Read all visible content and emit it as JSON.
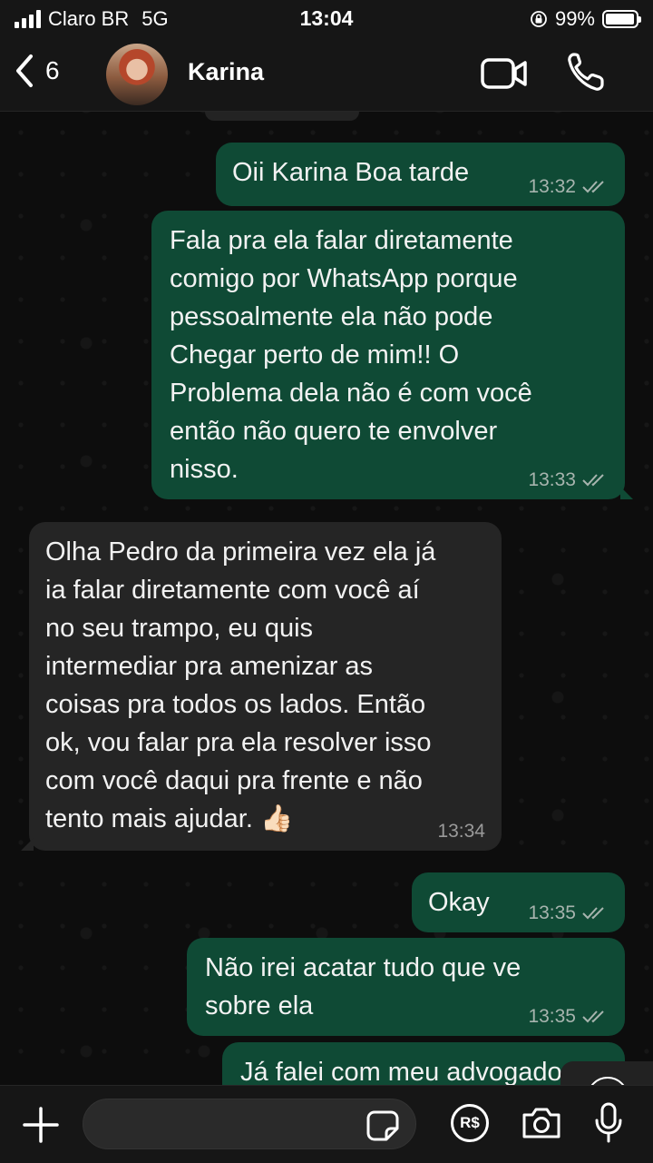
{
  "status_bar": {
    "carrier": "Claro BR",
    "network": "5G",
    "time": "13:04",
    "battery": "99%",
    "battery_level": 0.99
  },
  "header": {
    "back_count": "6",
    "contact_name": "Karina"
  },
  "messages": [
    {
      "direction": "out",
      "text": "Oii Karina Boa tarde",
      "time": "13:32",
      "status": "read"
    },
    {
      "direction": "out",
      "text": "Fala pra ela falar diretamente\ncomigo por WhatsApp porque\npessoalmente ela não pode\nChegar perto de mim!! O\nProblema dela não é com você\nentão não quero te envolver\nnisso.",
      "time": "13:33",
      "status": "read"
    },
    {
      "direction": "in",
      "text": "Olha Pedro da primeira vez ela já\nia falar diretamente com você aí\nno seu trampo, eu quis\nintermediar pra amenizar as\ncoisas pra todos os lados. Então\nok, vou falar pra ela resolver isso\ncom você daqui pra frente e não\ntento mais ajudar. 👍🏻",
      "time": "13:34"
    },
    {
      "direction": "out",
      "text": "Okay",
      "time": "13:35",
      "status": "read"
    },
    {
      "direction": "out",
      "text": "Não irei acatar tudo que ve\nsobre ela",
      "time": "13:35",
      "status": "read"
    },
    {
      "direction": "out",
      "text": "Já falei com meu advogado",
      "time": "",
      "status": ""
    }
  ],
  "icons": {
    "back": "chevron-left-icon",
    "video": "video-camera-icon",
    "call": "phone-icon",
    "scroll": "chevron-down-icon",
    "attach": "plus-icon",
    "sticker": "sticker-icon",
    "payment": "pix-real-icon",
    "camera": "camera-icon",
    "mic": "microphone-icon"
  },
  "bottom_bar": {
    "payment_label": "R$",
    "input_value": ""
  },
  "colors": {
    "outgoing_bubble": "#0f4a35",
    "incoming_bubble": "#252525",
    "background": "#0d0d0d"
  }
}
